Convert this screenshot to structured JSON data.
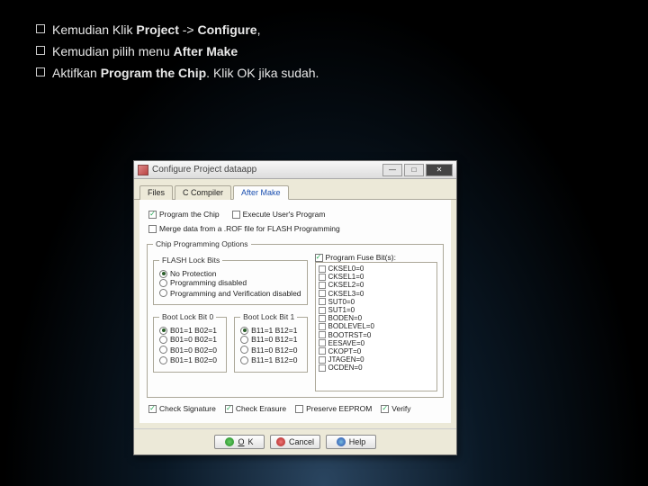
{
  "slide": {
    "line1_pre": "Kemudian Klik ",
    "line1_b1": "Project",
    "line1_mid": " -> ",
    "line1_b2": "Configure",
    "line1_suf": ",",
    "line2_pre": "Kemudian pilih menu ",
    "line2_b": "After Make",
    "line3_pre": "Aktifkan ",
    "line3_b": "Program the Chip",
    "line3_suf": ". Klik OK jika sudah."
  },
  "dialog": {
    "title": "Configure Project dataapp",
    "tabs": {
      "files": "Files",
      "ccomp": "C Compiler",
      "after": "After Make"
    },
    "opts": {
      "program_chip": "Program the Chip",
      "exec_user": "Execute User's Program",
      "merge": "Merge data from a .ROF file for FLASH Programming"
    },
    "groupbox": {
      "chip_prog": "Chip Programming Options",
      "flash_lock": "FLASH Lock Bits",
      "no_prot": "No Protection",
      "prog_disabled": "Programming disabled",
      "prog_ver_disabled": "Programming and Verification disabled",
      "boot_lock0": "Boot Lock Bit 0",
      "boot_lock1": "Boot Lock Bit 1",
      "b01": "B01=1 B02=1",
      "b02": "B01=0 B02=1",
      "b03": "B01=0 B02=0",
      "b04": "B01=1 B02=0",
      "b11": "B11=1 B12=1",
      "b12": "B11=0 B12=1",
      "b13": "B11=0 B12=0",
      "b14": "B11=1 B12=0",
      "fuse_title": "Program Fuse Bit(s):",
      "fuses": [
        "CKSEL0=0",
        "CKSEL1=0",
        "CKSEL2=0",
        "CKSEL3=0",
        "SUT0=0",
        "SUT1=0",
        "BODEN=0",
        "BODLEVEL=0",
        "BOOTRST=0",
        "EESAVE=0",
        "CKOPT=0",
        "JTAGEN=0",
        "OCDEN=0"
      ]
    },
    "bottom": {
      "check_sig": "Check Signature",
      "check_erase": "Check Erasure",
      "preserve": "Preserve EEPROM",
      "verify": "Verify"
    },
    "buttons": {
      "ok": "OK",
      "cancel": "Cancel",
      "help": "Help"
    }
  }
}
